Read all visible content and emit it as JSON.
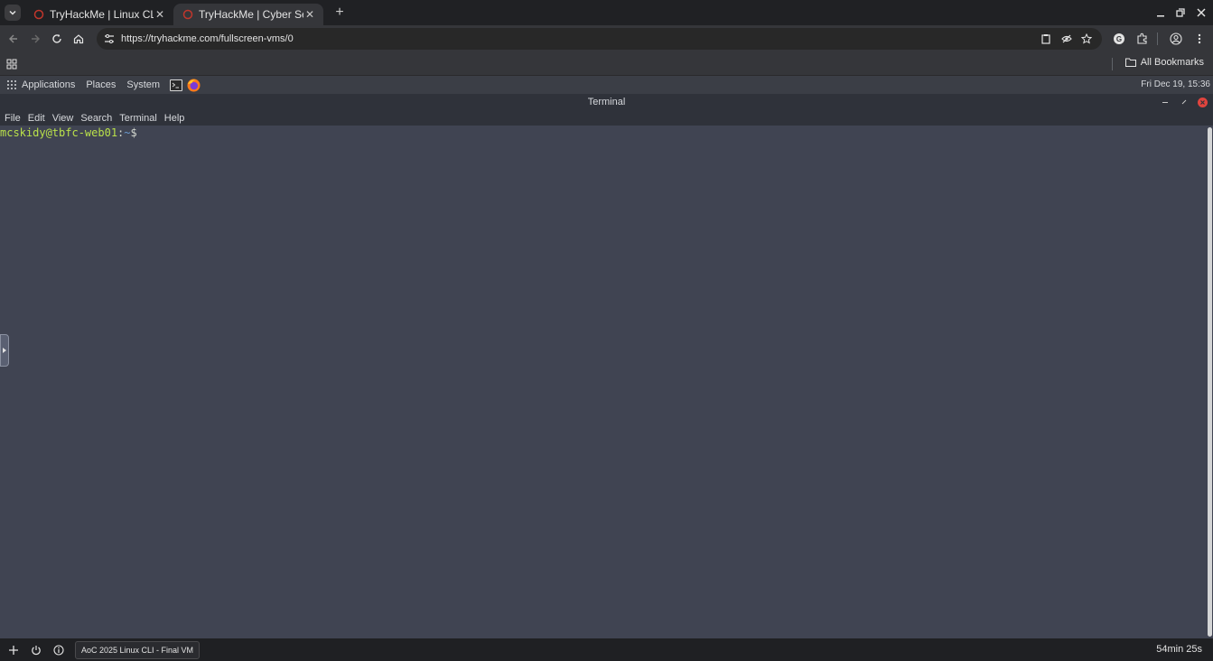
{
  "browser": {
    "tabs": [
      {
        "title": "TryHackMe | Linux CLI",
        "active": false
      },
      {
        "title": "TryHackMe | Cyber Sec",
        "active": true
      }
    ],
    "url": "https://tryhackme.com/fullscreen-vms/0",
    "bookmarks_label": "All Bookmarks"
  },
  "vm_panel": {
    "menus": [
      "Applications",
      "Places",
      "System"
    ],
    "clock": "Fri Dec 19, 15:36"
  },
  "terminal": {
    "title": "Terminal",
    "menu": [
      "File",
      "Edit",
      "View",
      "Search",
      "Terminal",
      "Help"
    ],
    "prompt": {
      "user_host": "mcskidy@tbfc-web01",
      "sep": ":",
      "path": "~",
      "symbol": "$"
    }
  },
  "bottom_bar": {
    "vm_name": "AoC 2025 Linux CLI - Final VM",
    "timer": "54min 25s"
  },
  "colors": {
    "terminal_bg": "#404452",
    "prompt_user": "#b9e04a",
    "accent_red": "#e0443e"
  }
}
